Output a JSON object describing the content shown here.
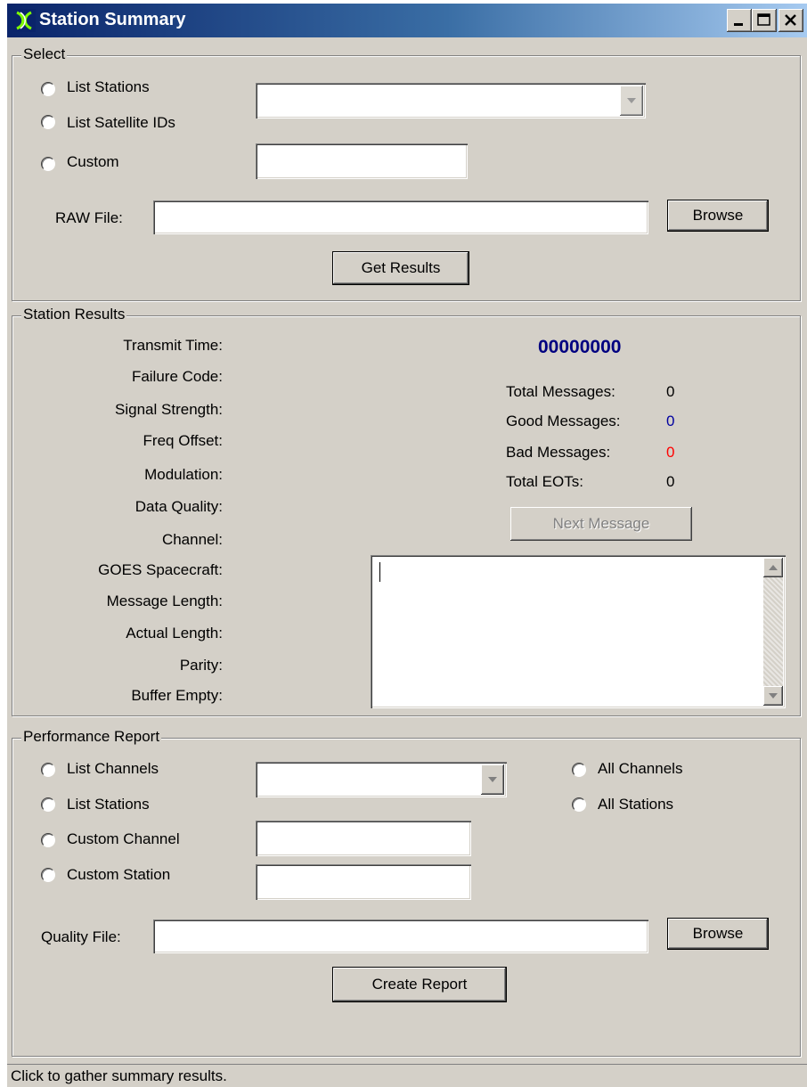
{
  "window": {
    "title": "Station Summary"
  },
  "select": {
    "legend": "Select",
    "radio_list_stations": "List Stations",
    "radio_list_satellite_ids": "List Satellite IDs",
    "radio_custom": "Custom",
    "combo_value": "",
    "custom_value": "",
    "raw_file_label": "RAW File:",
    "raw_file_value": "",
    "browse_label": "Browse",
    "get_results_label": "Get Results"
  },
  "results": {
    "legend": "Station Results",
    "labels": {
      "transmit_time": "Transmit Time:",
      "failure_code": "Failure Code:",
      "signal_strength": "Signal Strength:",
      "freq_offset": "Freq Offset:",
      "modulation": "Modulation:",
      "data_quality": "Data Quality:",
      "channel": "Channel:",
      "goes_spacecraft": "GOES Spacecraft:",
      "message_length": "Message Length:",
      "actual_length": "Actual Length:",
      "parity": "Parity:",
      "buffer_empty": "Buffer Empty:"
    },
    "station_id": "00000000",
    "total_messages_label": "Total Messages:",
    "total_messages": "0",
    "good_messages_label": "Good Messages:",
    "good_messages": "0",
    "bad_messages_label": "Bad Messages:",
    "bad_messages": "0",
    "total_eots_label": "Total EOTs:",
    "total_eots": "0",
    "next_message_label": "Next Message",
    "message_text": ""
  },
  "report": {
    "legend": "Performance Report",
    "radio_list_channels": "List Channels",
    "radio_list_stations": "List Stations",
    "radio_custom_channel": "Custom Channel",
    "radio_custom_station": "Custom Station",
    "radio_all_channels": "All Channels",
    "radio_all_stations": "All Stations",
    "quality_file_label": "Quality File:",
    "quality_file_value": "",
    "browse_label": "Browse",
    "create_report_label": "Create Report"
  },
  "status": {
    "text": "Click to gather summary results."
  },
  "colors": {
    "station_id": "#000080",
    "good": "#0000a0",
    "bad": "#ff0000"
  }
}
